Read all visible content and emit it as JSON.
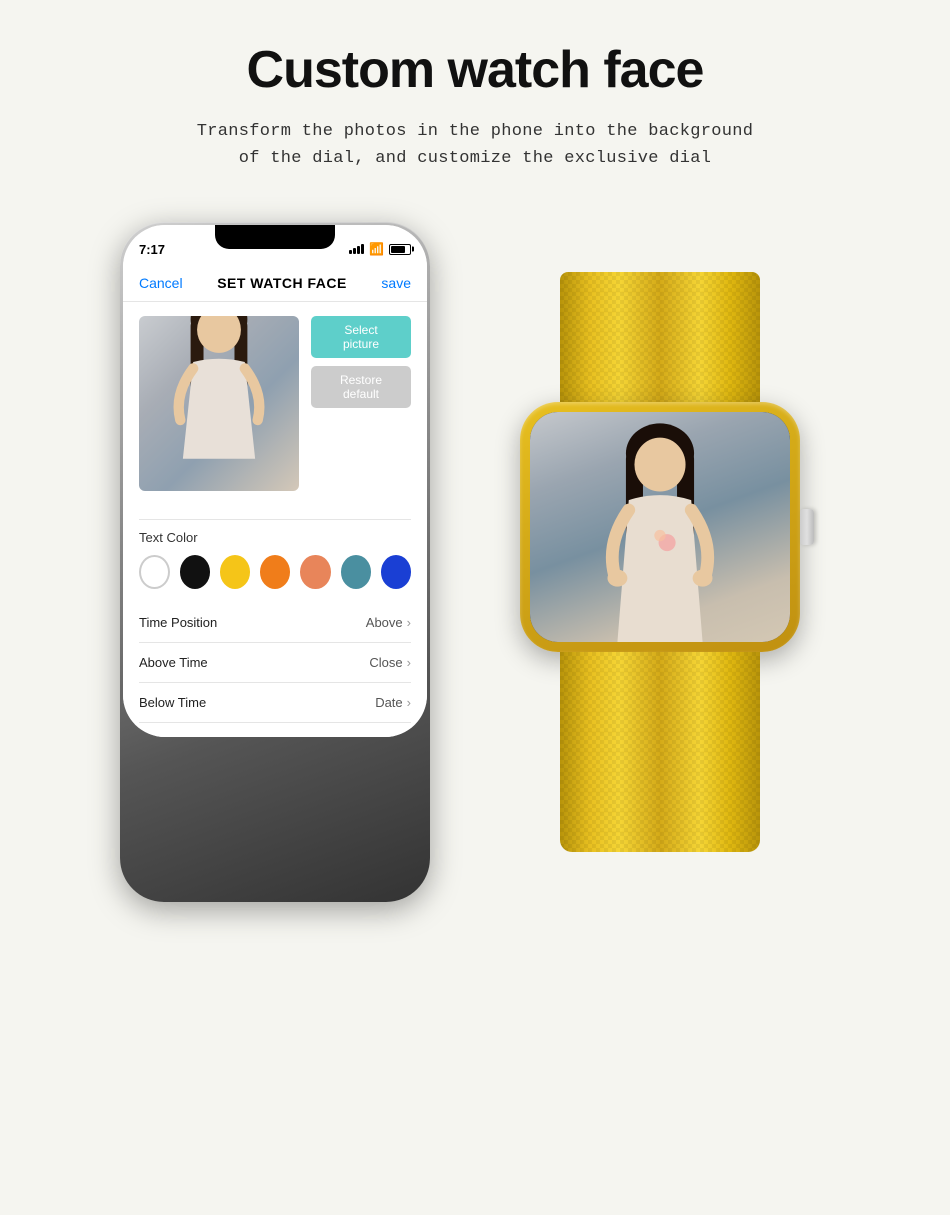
{
  "page": {
    "title": "Custom watch face",
    "subtitle_line1": "Transform the photos in the phone into the background",
    "subtitle_line2": "of the dial, and customize the exclusive dial"
  },
  "phone": {
    "time": "7:17",
    "cancel_label": "Cancel",
    "screen_title": "SET WATCH FACE",
    "save_label": "save",
    "select_picture_label": "Select picture",
    "restore_default_label": "Restore default",
    "text_color_label": "Text Color",
    "settings": [
      {
        "label": "Time Position",
        "value": "Above",
        "chevron": ">"
      },
      {
        "label": "Above Time",
        "value": "Close",
        "chevron": ">"
      },
      {
        "label": "Below Time",
        "value": "Date",
        "chevron": ">"
      }
    ],
    "colors": [
      "white",
      "black",
      "yellow",
      "orange",
      "salmon",
      "teal",
      "blue"
    ]
  }
}
